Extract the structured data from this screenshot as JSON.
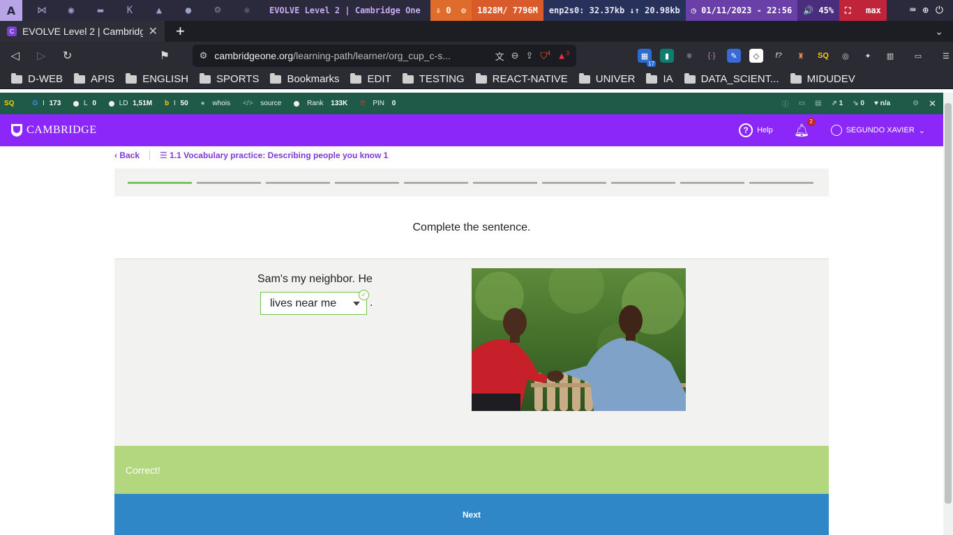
{
  "system": {
    "title": "EVOLVE Level 2 | Cambridge One",
    "downloads": "0",
    "memory": "1828M/ 7796M",
    "network": "enp2s0: 32.37kb ↓↑ 20.98kb",
    "datetime": "01/11/2023 - 22:56",
    "volume": "45%",
    "layout": "max"
  },
  "browser": {
    "tab_title": "EVOLVE Level 2 | Cambridge One",
    "url_domain": "cambridgeone.org",
    "url_path": "/learning-path/learner/org_cup_c-s...",
    "ext_badge_1": "4",
    "ext_badge_2": "3",
    "ext_badge_3": "17"
  },
  "bookmarks": [
    "D-WEB",
    "APIS",
    "ENGLISH",
    "SPORTS",
    "Bookmarks",
    "EDIT",
    "TESTING",
    "REACT-NATIVE",
    "UNIVER",
    "IA",
    "DATA_SCIENT...",
    "MIDUDEV"
  ],
  "seo": {
    "g": "173",
    "l": "0",
    "ld": "1,51M",
    "b": "50",
    "whois": "whois",
    "source": "source",
    "rank_label": "Rank",
    "rank": "133K",
    "pin_label": "PIN",
    "pin": "0",
    "ext_links": "1",
    "no_links": "0",
    "trust": "n/a"
  },
  "header": {
    "brand": "CAMBRIDGE",
    "help": "Help",
    "notifications": "2",
    "user": "SEGUNDO XAVIER"
  },
  "breadcrumb": {
    "back": "Back",
    "lesson": "1.1 Vocabulary practice: Describing people you know 1"
  },
  "progress": {
    "total": 10,
    "completed": 1
  },
  "exercise": {
    "instruction": "Complete the sentence.",
    "sentence_start": "Sam's my neighbor. He",
    "selected_answer": "lives near me",
    "sentence_end": "."
  },
  "feedback": {
    "message": "Correct!"
  },
  "actions": {
    "next": "Next"
  }
}
